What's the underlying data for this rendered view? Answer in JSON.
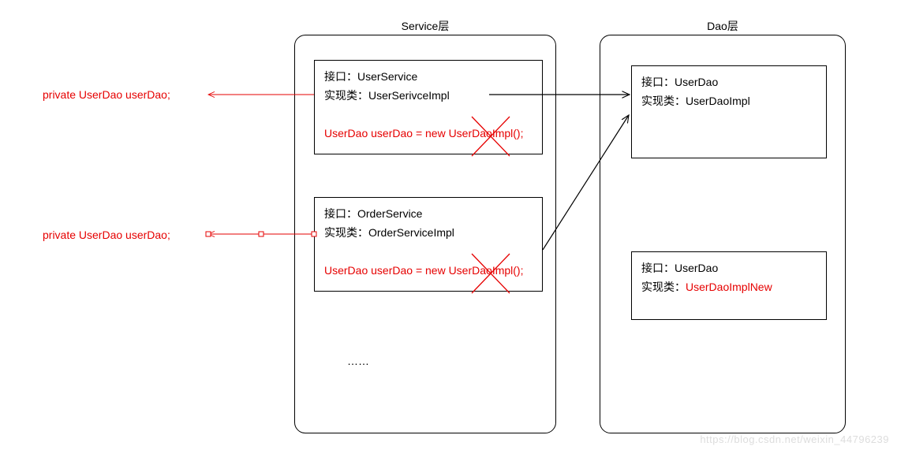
{
  "serviceLayer": {
    "title": "Service层",
    "box1": {
      "interfaceLabel": "接口：",
      "interfaceName": "UserService",
      "implLabel": "实现类：",
      "implName": "UserSerivceImpl",
      "code": "UserDao userDao = new UserDaoImpl();"
    },
    "box2": {
      "interfaceLabel": "接口：",
      "interfaceName": "OrderService",
      "implLabel": "实现类：",
      "implName": "OrderServiceImpl",
      "code": "UserDao userDao = new UserDaoImpl();"
    },
    "ellipsis": "……"
  },
  "daoLayer": {
    "title": "Dao层",
    "box1": {
      "interfaceLabel": "接口：",
      "interfaceName": "UserDao",
      "implLabel": "实现类：",
      "implName": "UserDaoImpl"
    },
    "box2": {
      "interfaceLabel": "接口：",
      "interfaceName": "UserDao",
      "implLabel": "实现类：",
      "implName": "UserDaoImplNew"
    }
  },
  "annotations": {
    "field1": "private UserDao userDao;",
    "field2": "private UserDao userDao;"
  },
  "watermark": "https://blog.csdn.net/weixin_44796239"
}
